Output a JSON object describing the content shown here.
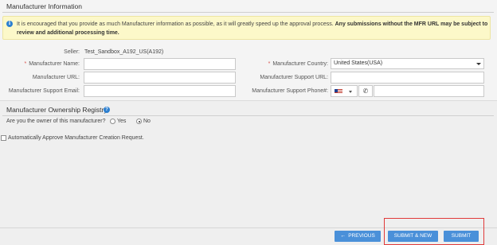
{
  "manufacturer_info": {
    "title": "Manufacturer Information",
    "notice": {
      "text": "It is encouraged that you provide as much Manufacturer information as possible, as it will greatly speed up the approval process.",
      "bold_text": "Any submissions without the MFR URL may be subject to review and additional processing time."
    },
    "seller": {
      "label": "Seller:",
      "value": "Test_Sandbox_A192_US(A192)"
    },
    "fields": {
      "manufacturer_name": {
        "label": "Manufacturer Name:",
        "required_mark": "*",
        "value": ""
      },
      "manufacturer_url": {
        "label": "Manufacturer URL:",
        "value": ""
      },
      "manufacturer_support_email": {
        "label": "Manufacturer Support Email:",
        "value": ""
      },
      "manufacturer_country": {
        "label": "Manufacturer Country:",
        "required_mark": "*",
        "value": "United States(USA)"
      },
      "manufacturer_support_url": {
        "label": "Manufacturer Support URL:",
        "value": ""
      },
      "manufacturer_support_phone": {
        "label": "Manufacturer Support Phone#:",
        "value": ""
      }
    }
  },
  "ownership": {
    "title": "Manufacturer Ownership Registry",
    "question": "Are you the owner of this manufacturer?",
    "options": [
      {
        "label": "Yes",
        "selected": false
      },
      {
        "label": "No",
        "selected": true
      }
    ]
  },
  "auto_approve": {
    "label": "Automatically Approve Manufacturer Creation Request.",
    "checked": false
  },
  "footer": {
    "previous_label": "PREVIOUS",
    "submit_new_label": "SUBMIT & NEW",
    "submit_label": "SUBMIT"
  },
  "colors": {
    "button": "#4a90d9",
    "info_icon": "#2c7fd0",
    "notice_bg": "#fcf8c9",
    "highlight_box": "#e03a3a",
    "required": "#d9534f"
  },
  "icons": {
    "info": "info-circle-icon",
    "help": "question-circle-icon",
    "phone": "phone-icon",
    "flag": "us-flag-icon",
    "previous": "arrow-left-icon"
  }
}
